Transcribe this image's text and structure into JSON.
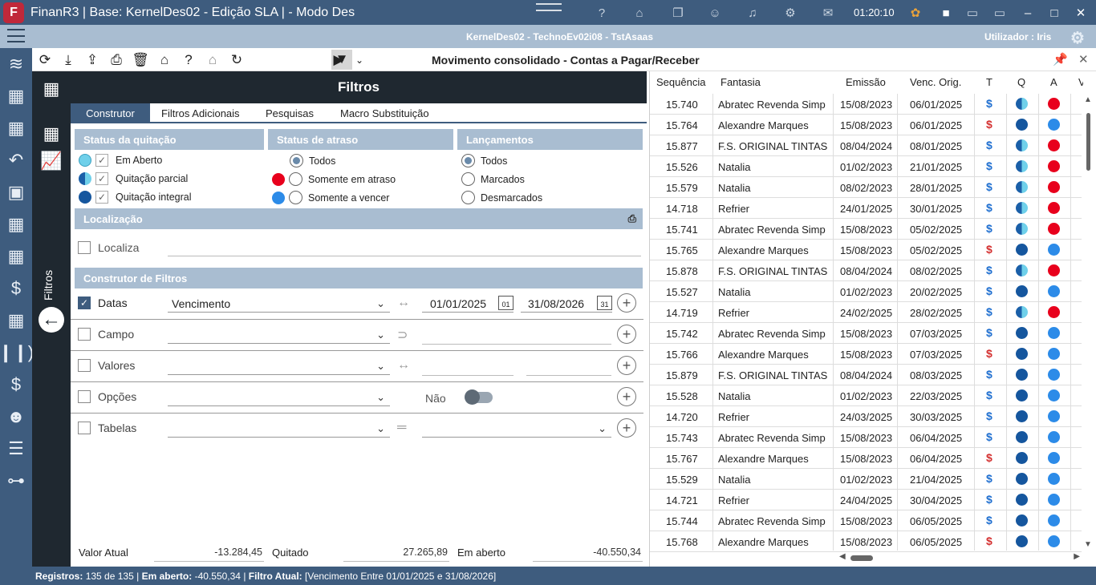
{
  "window": {
    "title": "FinanR3 | Base: KernelDes02 - Edição SLA | - Modo Des",
    "clock": "01:20:10",
    "logo_letter": "F"
  },
  "menubar": {
    "session": "KernelDes02 - TechnoEv02i08 - TstAsaas",
    "user": "Utilizador : Iris"
  },
  "toolbar": {
    "title": "Movimento consolidado - Contas a Pagar/Receber"
  },
  "side": {
    "label": "Filtros"
  },
  "filters": {
    "header": "Filtros",
    "tabs": [
      "Construtor",
      "Filtros Adicionais",
      "Pesquisas",
      "Macro Substituição"
    ],
    "status_quitacao": {
      "title": "Status da quitação",
      "options": [
        "Em Aberto",
        "Quitação parcial",
        "Quitação integral"
      ]
    },
    "status_atraso": {
      "title": "Status de atraso",
      "options": [
        "Todos",
        "Somente em atraso",
        "Somente a vencer"
      ],
      "selected": "Todos"
    },
    "lancamentos": {
      "title": "Lançamentos",
      "options": [
        "Todos",
        "Marcados",
        "Desmarcados"
      ],
      "selected": "Todos"
    },
    "localizacao": {
      "title": "Localização",
      "label": "Localiza"
    },
    "construtor": {
      "title": "Construtor de Filtros",
      "rows": [
        {
          "label": "Datas",
          "checked": true,
          "combo": "Vencimento",
          "from": "01/01/2025",
          "to": "31/08/2026",
          "cal_from": "01",
          "cal_to": "31"
        },
        {
          "label": "Campo",
          "checked": false,
          "combo": ""
        },
        {
          "label": "Valores",
          "checked": false,
          "combo": ""
        },
        {
          "label": "Opções",
          "checked": false,
          "combo": "",
          "toggle_label": "Não"
        },
        {
          "label": "Tabelas",
          "checked": false,
          "combo": ""
        }
      ]
    },
    "totals": {
      "valor_atual_label": "Valor Atual",
      "valor_atual": "-13.284,45",
      "quitado_label": "Quitado",
      "quitado": "27.265,89",
      "em_aberto_label": "Em aberto",
      "em_aberto": "-40.550,34"
    }
  },
  "grid": {
    "columns": [
      "Sequência",
      "Fantasia",
      "Emissão",
      "Venc. Orig.",
      "T",
      "Q",
      "A",
      "V"
    ],
    "rows": [
      {
        "seq": "15.740",
        "fantasia": "Abratec Revenda Simp",
        "emissao": "15/08/2023",
        "venc": "06/01/2025",
        "t": "blue",
        "q": "half",
        "a": "red"
      },
      {
        "seq": "15.764",
        "fantasia": "Alexandre Marques",
        "emissao": "15/08/2023",
        "venc": "06/01/2025",
        "t": "red",
        "q": "dark",
        "a": "blue"
      },
      {
        "seq": "15.877",
        "fantasia": "F.S. ORIGINAL TINTAS",
        "emissao": "08/04/2024",
        "venc": "08/01/2025",
        "t": "blue",
        "q": "half",
        "a": "red"
      },
      {
        "seq": "15.526",
        "fantasia": "Natalia",
        "emissao": "01/02/2023",
        "venc": "21/01/2025",
        "t": "blue",
        "q": "half",
        "a": "red"
      },
      {
        "seq": "15.579",
        "fantasia": "Natalia",
        "emissao": "08/02/2023",
        "venc": "28/01/2025",
        "t": "blue",
        "q": "half",
        "a": "red"
      },
      {
        "seq": "14.718",
        "fantasia": "Refrier",
        "emissao": "24/01/2025",
        "venc": "30/01/2025",
        "t": "blue",
        "q": "half",
        "a": "red"
      },
      {
        "seq": "15.741",
        "fantasia": "Abratec Revenda Simp",
        "emissao": "15/08/2023",
        "venc": "05/02/2025",
        "t": "blue",
        "q": "half",
        "a": "red"
      },
      {
        "seq": "15.765",
        "fantasia": "Alexandre Marques",
        "emissao": "15/08/2023",
        "venc": "05/02/2025",
        "t": "red",
        "q": "dark",
        "a": "blue"
      },
      {
        "seq": "15.878",
        "fantasia": "F.S. ORIGINAL TINTAS",
        "emissao": "08/04/2024",
        "venc": "08/02/2025",
        "t": "blue",
        "q": "half",
        "a": "red"
      },
      {
        "seq": "15.527",
        "fantasia": "Natalia",
        "emissao": "01/02/2023",
        "venc": "20/02/2025",
        "t": "blue",
        "q": "dark",
        "a": "blue"
      },
      {
        "seq": "14.719",
        "fantasia": "Refrier",
        "emissao": "24/02/2025",
        "venc": "28/02/2025",
        "t": "blue",
        "q": "half",
        "a": "red"
      },
      {
        "seq": "15.742",
        "fantasia": "Abratec Revenda Simp",
        "emissao": "15/08/2023",
        "venc": "07/03/2025",
        "t": "blue",
        "q": "dark",
        "a": "blue"
      },
      {
        "seq": "15.766",
        "fantasia": "Alexandre Marques",
        "emissao": "15/08/2023",
        "venc": "07/03/2025",
        "t": "red",
        "q": "dark",
        "a": "blue"
      },
      {
        "seq": "15.879",
        "fantasia": "F.S. ORIGINAL TINTAS",
        "emissao": "08/04/2024",
        "venc": "08/03/2025",
        "t": "blue",
        "q": "dark",
        "a": "blue"
      },
      {
        "seq": "15.528",
        "fantasia": "Natalia",
        "emissao": "01/02/2023",
        "venc": "22/03/2025",
        "t": "blue",
        "q": "dark",
        "a": "blue"
      },
      {
        "seq": "14.720",
        "fantasia": "Refrier",
        "emissao": "24/03/2025",
        "venc": "30/03/2025",
        "t": "blue",
        "q": "dark",
        "a": "blue"
      },
      {
        "seq": "15.743",
        "fantasia": "Abratec Revenda Simp",
        "emissao": "15/08/2023",
        "venc": "06/04/2025",
        "t": "blue",
        "q": "dark",
        "a": "blue"
      },
      {
        "seq": "15.767",
        "fantasia": "Alexandre Marques",
        "emissao": "15/08/2023",
        "venc": "06/04/2025",
        "t": "red",
        "q": "dark",
        "a": "blue"
      },
      {
        "seq": "15.529",
        "fantasia": "Natalia",
        "emissao": "01/02/2023",
        "venc": "21/04/2025",
        "t": "blue",
        "q": "dark",
        "a": "blue"
      },
      {
        "seq": "14.721",
        "fantasia": "Refrier",
        "emissao": "24/04/2025",
        "venc": "30/04/2025",
        "t": "blue",
        "q": "dark",
        "a": "blue"
      },
      {
        "seq": "15.744",
        "fantasia": "Abratec Revenda Simp",
        "emissao": "15/08/2023",
        "venc": "06/05/2025",
        "t": "blue",
        "q": "dark",
        "a": "blue"
      },
      {
        "seq": "15.768",
        "fantasia": "Alexandre Marques",
        "emissao": "15/08/2023",
        "venc": "06/05/2025",
        "t": "red",
        "q": "dark",
        "a": "blue"
      }
    ]
  },
  "status": {
    "registros_label": "Registros:",
    "registros": "135 de 135",
    "em_aberto_label": "Em aberto:",
    "em_aberto": "-40.550,34",
    "filtro_label": "Filtro Atual:",
    "filtro": "[Vencimento Entre 01/01/2025 e 31/08/2026]",
    "sep": "|"
  },
  "colors": {
    "brand": "#3e5c7e",
    "header_light": "#a9bdd1",
    "dark_panel": "#1f2830",
    "red": "#e8001c",
    "blue": "#2c8be8",
    "navy": "#15569e",
    "currency_blue": "#1f6fd0",
    "currency_red": "#d43030"
  }
}
